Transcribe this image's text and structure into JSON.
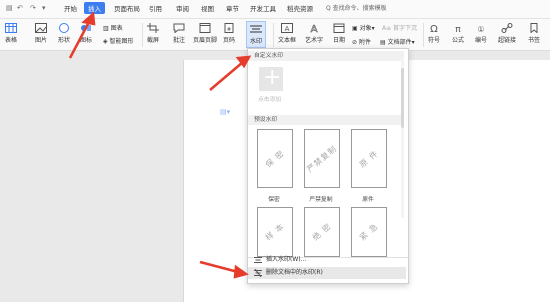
{
  "quick_access": [
    "↶",
    "↷"
  ],
  "menu": {
    "items": [
      "开始",
      "插入",
      "页面布局",
      "引用",
      "审阅",
      "视图",
      "章节",
      "开发工具",
      "稻壳资源"
    ],
    "active": "插入"
  },
  "search_placeholder": "Q 查找命令、搜索模板",
  "ribbon": {
    "table": "表格",
    "picture": "图片",
    "shape": "形状",
    "icon": "图标",
    "chart": "图表",
    "smart_shape": "智能图形",
    "screenshot": "截屏",
    "comment": "批注",
    "header_footer": "页眉页脚",
    "page_number": "页码",
    "watermark": "水印",
    "textbox": "文本框",
    "art_text": "艺术字",
    "date": "日期",
    "object": "对象",
    "first_drop": "首字下沉",
    "attachment": "附件",
    "doc_parts": "文档部件",
    "symbol": "符号",
    "formula": "公式",
    "numbering": "编号",
    "hyperlink": "超链接",
    "bookmark": "书签"
  },
  "watermark_panel": {
    "custom_section": "自定义水印",
    "add_label": "点击添加",
    "preset_section": "预设水印",
    "presets_row1": [
      {
        "text": "保 密",
        "caption": "保密"
      },
      {
        "text": "严禁复制",
        "caption": "严禁复制"
      },
      {
        "text": "原 件",
        "caption": "原件"
      }
    ],
    "presets_row2": [
      {
        "text": "样 本"
      },
      {
        "text": "绝 密"
      },
      {
        "text": "紧 急"
      }
    ],
    "insert_cmd": "插入水印(W)...",
    "delete_cmd": "删除文档中的水印(R)"
  },
  "colors": {
    "accent": "#3c7ef0",
    "arrow": "#e53c2c"
  }
}
